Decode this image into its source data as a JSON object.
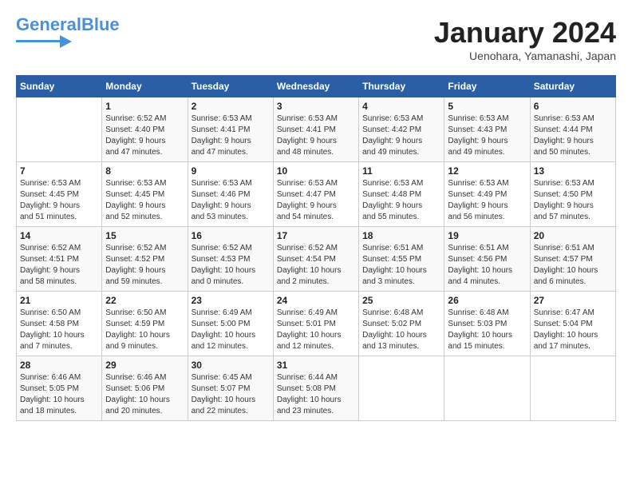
{
  "header": {
    "logo_general": "General",
    "logo_blue": "Blue",
    "month_title": "January 2024",
    "location": "Uenohara, Yamanashi, Japan"
  },
  "days_of_week": [
    "Sunday",
    "Monday",
    "Tuesday",
    "Wednesday",
    "Thursday",
    "Friday",
    "Saturday"
  ],
  "weeks": [
    [
      {
        "day": "",
        "info": ""
      },
      {
        "day": "1",
        "info": "Sunrise: 6:52 AM\nSunset: 4:40 PM\nDaylight: 9 hours\nand 47 minutes."
      },
      {
        "day": "2",
        "info": "Sunrise: 6:53 AM\nSunset: 4:41 PM\nDaylight: 9 hours\nand 47 minutes."
      },
      {
        "day": "3",
        "info": "Sunrise: 6:53 AM\nSunset: 4:41 PM\nDaylight: 9 hours\nand 48 minutes."
      },
      {
        "day": "4",
        "info": "Sunrise: 6:53 AM\nSunset: 4:42 PM\nDaylight: 9 hours\nand 49 minutes."
      },
      {
        "day": "5",
        "info": "Sunrise: 6:53 AM\nSunset: 4:43 PM\nDaylight: 9 hours\nand 49 minutes."
      },
      {
        "day": "6",
        "info": "Sunrise: 6:53 AM\nSunset: 4:44 PM\nDaylight: 9 hours\nand 50 minutes."
      }
    ],
    [
      {
        "day": "7",
        "info": "Sunrise: 6:53 AM\nSunset: 4:45 PM\nDaylight: 9 hours\nand 51 minutes."
      },
      {
        "day": "8",
        "info": "Sunrise: 6:53 AM\nSunset: 4:45 PM\nDaylight: 9 hours\nand 52 minutes."
      },
      {
        "day": "9",
        "info": "Sunrise: 6:53 AM\nSunset: 4:46 PM\nDaylight: 9 hours\nand 53 minutes."
      },
      {
        "day": "10",
        "info": "Sunrise: 6:53 AM\nSunset: 4:47 PM\nDaylight: 9 hours\nand 54 minutes."
      },
      {
        "day": "11",
        "info": "Sunrise: 6:53 AM\nSunset: 4:48 PM\nDaylight: 9 hours\nand 55 minutes."
      },
      {
        "day": "12",
        "info": "Sunrise: 6:53 AM\nSunset: 4:49 PM\nDaylight: 9 hours\nand 56 minutes."
      },
      {
        "day": "13",
        "info": "Sunrise: 6:53 AM\nSunset: 4:50 PM\nDaylight: 9 hours\nand 57 minutes."
      }
    ],
    [
      {
        "day": "14",
        "info": "Sunrise: 6:52 AM\nSunset: 4:51 PM\nDaylight: 9 hours\nand 58 minutes."
      },
      {
        "day": "15",
        "info": "Sunrise: 6:52 AM\nSunset: 4:52 PM\nDaylight: 9 hours\nand 59 minutes."
      },
      {
        "day": "16",
        "info": "Sunrise: 6:52 AM\nSunset: 4:53 PM\nDaylight: 10 hours\nand 0 minutes."
      },
      {
        "day": "17",
        "info": "Sunrise: 6:52 AM\nSunset: 4:54 PM\nDaylight: 10 hours\nand 2 minutes."
      },
      {
        "day": "18",
        "info": "Sunrise: 6:51 AM\nSunset: 4:55 PM\nDaylight: 10 hours\nand 3 minutes."
      },
      {
        "day": "19",
        "info": "Sunrise: 6:51 AM\nSunset: 4:56 PM\nDaylight: 10 hours\nand 4 minutes."
      },
      {
        "day": "20",
        "info": "Sunrise: 6:51 AM\nSunset: 4:57 PM\nDaylight: 10 hours\nand 6 minutes."
      }
    ],
    [
      {
        "day": "21",
        "info": "Sunrise: 6:50 AM\nSunset: 4:58 PM\nDaylight: 10 hours\nand 7 minutes."
      },
      {
        "day": "22",
        "info": "Sunrise: 6:50 AM\nSunset: 4:59 PM\nDaylight: 10 hours\nand 9 minutes."
      },
      {
        "day": "23",
        "info": "Sunrise: 6:49 AM\nSunset: 5:00 PM\nDaylight: 10 hours\nand 12 minutes."
      },
      {
        "day": "24",
        "info": "Sunrise: 6:49 AM\nSunset: 5:01 PM\nDaylight: 10 hours\nand 12 minutes."
      },
      {
        "day": "25",
        "info": "Sunrise: 6:48 AM\nSunset: 5:02 PM\nDaylight: 10 hours\nand 13 minutes."
      },
      {
        "day": "26",
        "info": "Sunrise: 6:48 AM\nSunset: 5:03 PM\nDaylight: 10 hours\nand 15 minutes."
      },
      {
        "day": "27",
        "info": "Sunrise: 6:47 AM\nSunset: 5:04 PM\nDaylight: 10 hours\nand 17 minutes."
      }
    ],
    [
      {
        "day": "28",
        "info": "Sunrise: 6:46 AM\nSunset: 5:05 PM\nDaylight: 10 hours\nand 18 minutes."
      },
      {
        "day": "29",
        "info": "Sunrise: 6:46 AM\nSunset: 5:06 PM\nDaylight: 10 hours\nand 20 minutes."
      },
      {
        "day": "30",
        "info": "Sunrise: 6:45 AM\nSunset: 5:07 PM\nDaylight: 10 hours\nand 22 minutes."
      },
      {
        "day": "31",
        "info": "Sunrise: 6:44 AM\nSunset: 5:08 PM\nDaylight: 10 hours\nand 23 minutes."
      },
      {
        "day": "",
        "info": ""
      },
      {
        "day": "",
        "info": ""
      },
      {
        "day": "",
        "info": ""
      }
    ]
  ]
}
